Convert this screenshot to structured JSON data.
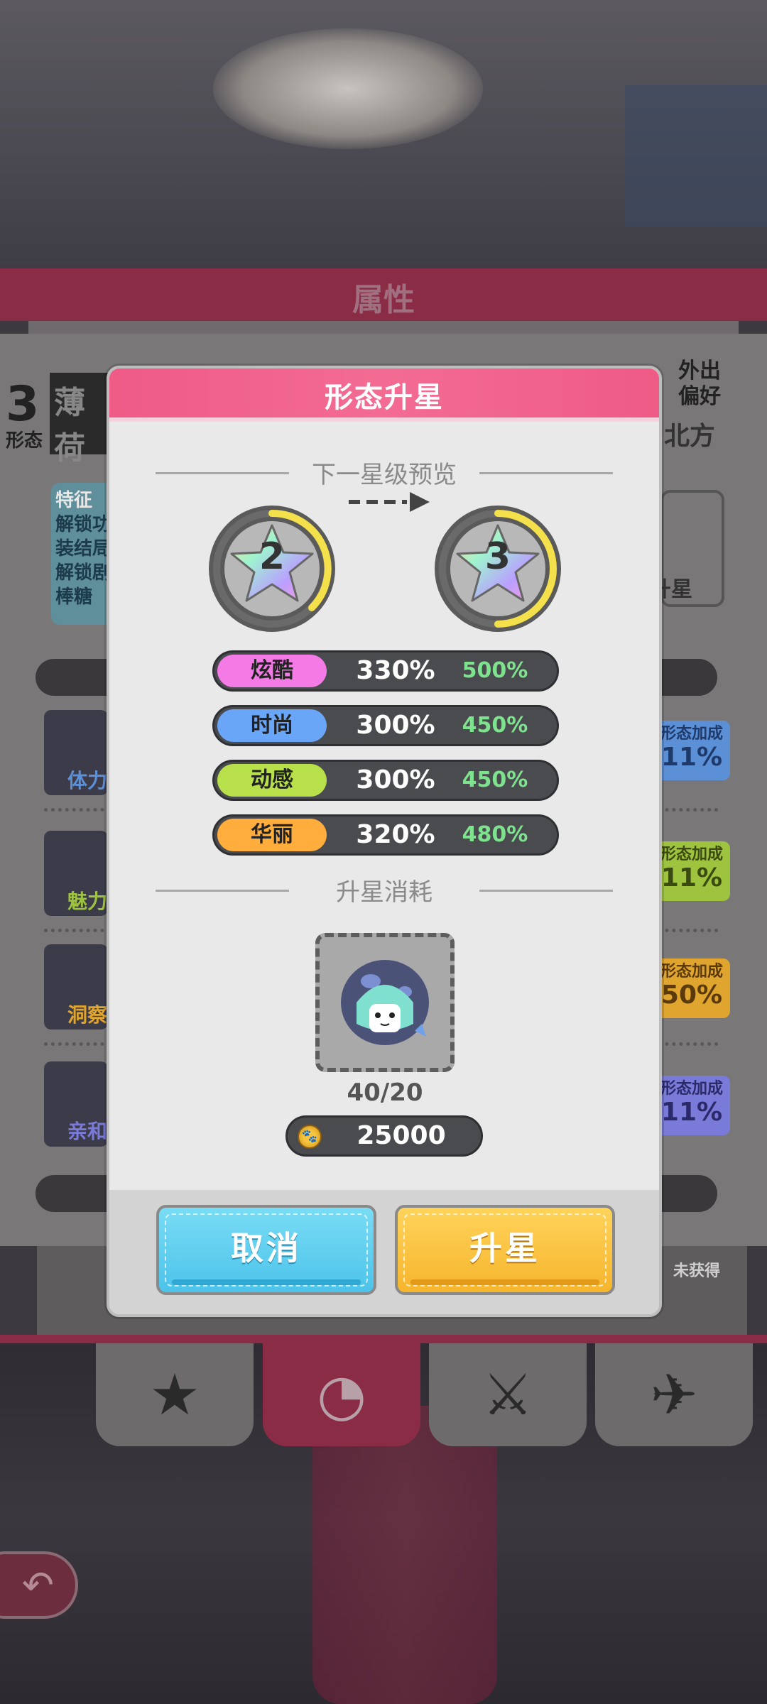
{
  "panel": {
    "title": "属性",
    "form_number": "3",
    "form_label": "形态",
    "name": "薄荷",
    "outing_pref_label": "外出偏好",
    "outing_pref_value": "北方",
    "feature_label": "特征",
    "feature_lines": [
      "解锁功",
      "装结局",
      "解锁剧",
      "棒糖"
    ],
    "upgrade_label": "升星",
    "stats": [
      {
        "label": "体力",
        "bonus_label": "形态加成",
        "bonus": "11%",
        "color": "#5b8fd6"
      },
      {
        "label": "魅力",
        "bonus_label": "形态加成",
        "bonus": "11%",
        "color": "#9ec33f"
      },
      {
        "label": "洞察",
        "bonus_label": "形态加成",
        "bonus": "50%",
        "color": "#e0a52e"
      },
      {
        "label": "亲和",
        "bonus_label": "形态加成",
        "bonus": "11%",
        "color": "#7a7ad8"
      }
    ]
  },
  "tabs": {
    "not_obtained": "未获得",
    "nav": [
      {
        "name": "star-plus",
        "glyph": "★"
      },
      {
        "name": "form",
        "glyph": "◔"
      },
      {
        "name": "interact",
        "glyph": "⚔"
      },
      {
        "name": "outing",
        "glyph": "✈"
      }
    ]
  },
  "dialog": {
    "title": "形态升星",
    "preview_title": "下一星级预览",
    "from_star": "2",
    "to_star": "3",
    "stats": [
      {
        "label": "炫酷",
        "current": "330%",
        "next": "500%",
        "color": "#f47be5"
      },
      {
        "label": "时尚",
        "current": "300%",
        "next": "450%",
        "color": "#6aa6f8"
      },
      {
        "label": "动感",
        "current": "300%",
        "next": "450%",
        "color": "#b8e04a"
      },
      {
        "label": "华丽",
        "current": "320%",
        "next": "480%",
        "color": "#ffae3d"
      }
    ],
    "cost_title": "升星消耗",
    "item_count": "40/20",
    "coin_cost": "25000",
    "cancel_label": "取消",
    "confirm_label": "升星"
  },
  "colors": {
    "header_pink": "#f0648f",
    "cancel_blue": "#56c8ee",
    "confirm_yellow": "#f8be39",
    "next_value_green": "#7fe28e"
  }
}
